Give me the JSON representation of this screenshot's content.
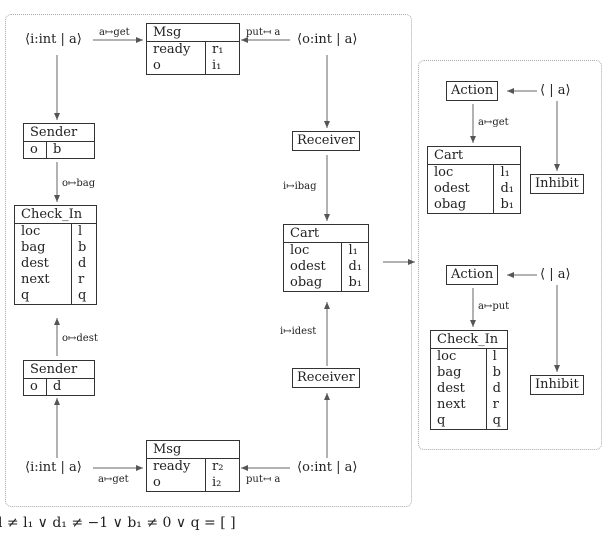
{
  "left_group": {
    "msg_top": {
      "title": "Msg",
      "rows": [
        [
          "ready",
          "r₁"
        ],
        [
          "o",
          "i₁"
        ]
      ]
    },
    "msg_bottom": {
      "title": "Msg",
      "rows": [
        [
          "ready",
          "r₂"
        ],
        [
          "o",
          "i₂"
        ]
      ]
    },
    "in_port_top": "⟨i:int | a⟩",
    "out_port_top": "⟨o:int | a⟩",
    "in_port_bottom": "⟨i:int | a⟩",
    "out_port_bottom": "⟨o:int | a⟩",
    "label_get_top": "a↦get",
    "label_put_top": "put↤ a",
    "label_get_bottom": "a↦get",
    "label_put_bottom": "put↤ a",
    "sender_top": {
      "title": "Sender",
      "rows": [
        [
          "o",
          "b"
        ]
      ]
    },
    "sender_bottom": {
      "title": "Sender",
      "rows": [
        [
          "o",
          "d"
        ]
      ]
    },
    "label_bag": "o↦bag",
    "label_dest": "o↦dest",
    "checkin": {
      "title": "Check_In",
      "rows": [
        [
          "loc",
          "l"
        ],
        [
          "bag",
          "b"
        ],
        [
          "dest",
          "d"
        ],
        [
          "next",
          "r"
        ],
        [
          "q",
          "q"
        ]
      ]
    },
    "receiver_top": "Receiver",
    "receiver_bottom": "Receiver",
    "label_ibag": "i↦ibag",
    "label_idest": "i↦idest",
    "cart": {
      "title": "Cart",
      "rows": [
        [
          "loc",
          "l₁"
        ],
        [
          "odest",
          "d₁"
        ],
        [
          "obag",
          "b₁"
        ]
      ]
    }
  },
  "right_group": {
    "action_top": "Action",
    "action_bottom": "Action",
    "port_top": "⟨ | a⟩",
    "port_bottom": "⟨ | a⟩",
    "label_get": "a↦get",
    "label_put": "a↦put",
    "inhibit_top": "Inhibit",
    "inhibit_bottom": "Inhibit",
    "cart": {
      "title": "Cart",
      "rows": [
        [
          "loc",
          "l₁"
        ],
        [
          "odest",
          "d₁"
        ],
        [
          "obag",
          "b₁"
        ]
      ]
    },
    "checkin": {
      "title": "Check_In",
      "rows": [
        [
          "loc",
          "l"
        ],
        [
          "bag",
          "b"
        ],
        [
          "dest",
          "d"
        ],
        [
          "next",
          "r"
        ],
        [
          "q",
          "q"
        ]
      ]
    }
  },
  "condition": "l ≠ l₁ ∨ d₁ ≠ −1 ∨ b₁ ≠ 0 ∨ q = [ ]"
}
